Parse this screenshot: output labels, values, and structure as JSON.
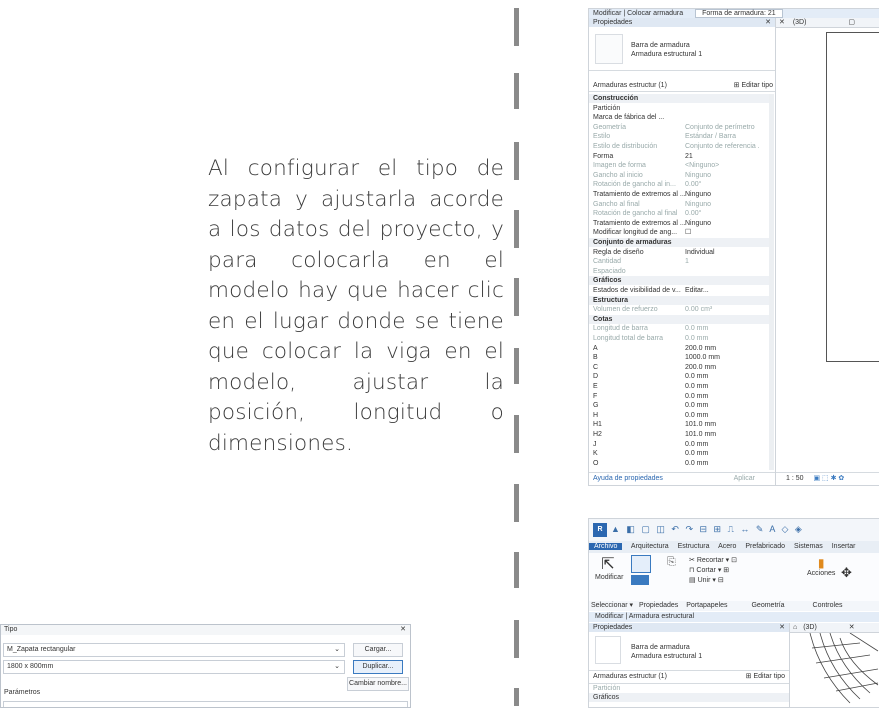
{
  "body_text": "Al configurar el tipo de zapata y ajustarla acorde a los datos del proyecto, y para colocarla en el modelo hay que hacer clic en el lugar donde se tiene que colocar la viga en el modelo, ajustar la posición, longitud o dimensiones.",
  "shot_top": {
    "title_bar": "Modificar | Colocar armadura",
    "title_extra": "Forma de armadura: 21",
    "panel_title": "Propiedades",
    "view_tab": "(3D)",
    "type_line1": "Barra de armadura",
    "type_line2": "Armadura estructural 1",
    "filter": "Armaduras estructur (1)",
    "edit_type": "Editar tipo",
    "rows": [
      {
        "kind": "group",
        "label": "Construcción",
        "value": ""
      },
      {
        "kind": "row",
        "label": "Partición",
        "value": ""
      },
      {
        "kind": "row",
        "label": "Marca de fábrica del ...",
        "value": ""
      },
      {
        "kind": "row",
        "label": "Geometría",
        "value": "Conjunto de perímetro",
        "muted": true
      },
      {
        "kind": "row",
        "label": "Estilo",
        "value": "Estándar / Barra",
        "muted": true
      },
      {
        "kind": "row",
        "label": "Estilo de distribución",
        "value": "Conjunto de referencia ...",
        "muted": true
      },
      {
        "kind": "row",
        "label": "Forma",
        "value": "21"
      },
      {
        "kind": "row",
        "label": "Imagen de forma",
        "value": "<Ninguno>",
        "muted": true
      },
      {
        "kind": "row",
        "label": "Gancho al inicio",
        "value": "Ninguno",
        "muted": true
      },
      {
        "kind": "row",
        "label": "Rotación de gancho al in...",
        "value": "0.00°",
        "muted": true
      },
      {
        "kind": "row",
        "label": "Tratamiento de extremos al ...",
        "value": "Ninguno"
      },
      {
        "kind": "row",
        "label": "Gancho al final",
        "value": "Ninguno",
        "muted": true
      },
      {
        "kind": "row",
        "label": "Rotación de gancho al final",
        "value": "0.00°",
        "muted": true
      },
      {
        "kind": "row",
        "label": "Tratamiento de extremos al ...",
        "value": "Ninguno"
      },
      {
        "kind": "row",
        "label": "Modificar longitud de ang...",
        "value": "☐"
      },
      {
        "kind": "group",
        "label": "Conjunto de armaduras",
        "value": ""
      },
      {
        "kind": "row",
        "label": "Regla de diseño",
        "value": "Individual"
      },
      {
        "kind": "row",
        "label": "Cantidad",
        "value": "1",
        "muted": true
      },
      {
        "kind": "row",
        "label": "Espaciado",
        "value": "",
        "muted": true
      },
      {
        "kind": "group",
        "label": "Gráficos",
        "value": ""
      },
      {
        "kind": "row",
        "label": "Estados de visibilidad de v...",
        "value": "Editar..."
      },
      {
        "kind": "group",
        "label": "Estructura",
        "value": ""
      },
      {
        "kind": "row",
        "label": "Volumen de refuerzo",
        "value": "0.00 cm³",
        "muted": true
      },
      {
        "kind": "group",
        "label": "Cotas",
        "value": ""
      },
      {
        "kind": "row",
        "label": "Longitud de barra",
        "value": "0.0 mm",
        "muted": true
      },
      {
        "kind": "row",
        "label": "Longitud total de barra",
        "value": "0.0 mm",
        "muted": true
      },
      {
        "kind": "row",
        "label": "A",
        "value": "200.0 mm"
      },
      {
        "kind": "row",
        "label": "B",
        "value": "1000.0 mm"
      },
      {
        "kind": "row",
        "label": "C",
        "value": "200.0 mm"
      },
      {
        "kind": "row",
        "label": "D",
        "value": "0.0 mm"
      },
      {
        "kind": "row",
        "label": "E",
        "value": "0.0 mm"
      },
      {
        "kind": "row",
        "label": "F",
        "value": "0.0 mm"
      },
      {
        "kind": "row",
        "label": "G",
        "value": "0.0 mm"
      },
      {
        "kind": "row",
        "label": "H",
        "value": "0.0 mm"
      },
      {
        "kind": "row",
        "label": "H1",
        "value": "101.0 mm"
      },
      {
        "kind": "row",
        "label": "H2",
        "value": "101.0 mm"
      },
      {
        "kind": "row",
        "label": "J",
        "value": "0.0 mm"
      },
      {
        "kind": "row",
        "label": "K",
        "value": "0.0 mm"
      },
      {
        "kind": "row",
        "label": "O",
        "value": "0.0 mm"
      }
    ],
    "help_link": "Ayuda de propiedades",
    "apply": "Aplicar",
    "scale": "1 : 50"
  },
  "shot_bottom": {
    "quick_access": "▲ ◧ ▢ ◫ ↶ ↷ ⊟ ⊞ ⎍ ↔ ✎ A ◇ ◈",
    "tabs": [
      "Archivo",
      "Arquitectura",
      "Estructura",
      "Acero",
      "Prefabricado",
      "Sistemas",
      "Insertar"
    ],
    "tools": {
      "modify": "Modificar",
      "actions": "Acciones",
      "recortar": "Recortar",
      "cortar": "Cortar",
      "unir": "Unir"
    },
    "panels": [
      "Seleccionar ▾",
      "Propiedades",
      "Portapapeles",
      "Geometría",
      "Controles"
    ],
    "context_bar": "Modificar | Armadura estructural",
    "panel_title": "Propiedades",
    "view_tab": "(3D)",
    "type_line1": "Barra de armadura",
    "type_line2": "Armadura estructural 1",
    "filter": "Armaduras estructur (1)",
    "edit_type": "Editar tipo",
    "row1": "Partición",
    "row2": "Gráficos"
  },
  "shot_dialog": {
    "title": "Tipo",
    "family_value": "M_Zapata rectangular",
    "type_value": "1800 x 800mm",
    "buttons": [
      "Cargar...",
      "Duplicar...",
      "Cambiar nombre..."
    ],
    "section_label": "Parámetros",
    "close": "✕"
  }
}
